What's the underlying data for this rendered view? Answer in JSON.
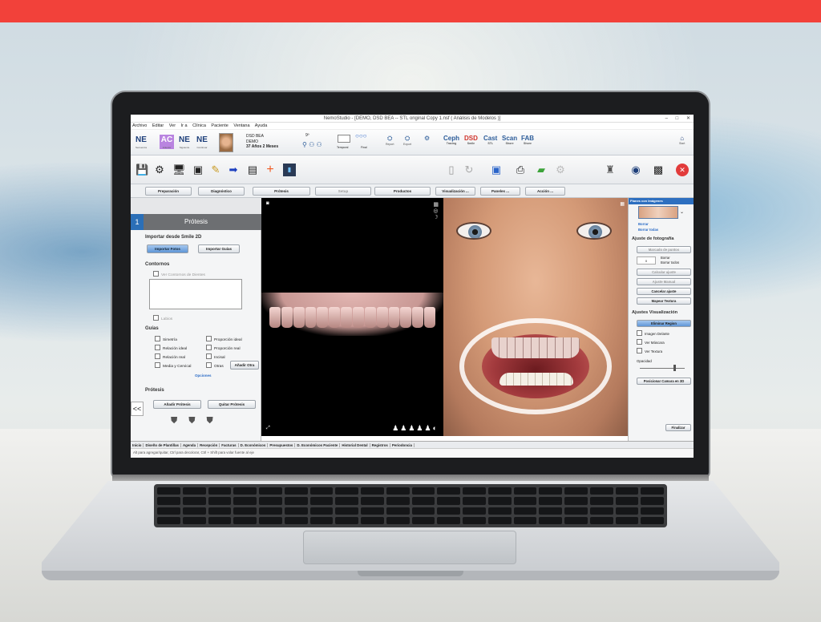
{
  "window": {
    "title": "NemoStudio - [DEMO, DSD BEA -- STL original Copy 1.nsf ( Análisis de Modelos )]",
    "controls": [
      "–",
      "□",
      "✕"
    ]
  },
  "menu": [
    "Archivo",
    "Editar",
    "Ver",
    "Ir a",
    "Clínica",
    "Paciente",
    "Ventana",
    "Ayuda"
  ],
  "toolbar1": {
    "modules": [
      {
        "abbr": "NE",
        "sub": "Secuencia"
      },
      {
        "abbr": "AC",
        "sub": "Anterior"
      },
      {
        "abbr": "NE",
        "sub": "Siguiente"
      },
      {
        "abbr": "NE",
        "sub": "Continuar"
      }
    ],
    "patient": {
      "name": "DSD BEA",
      "id": "DEMO",
      "age": "37 Años 2 Meses",
      "count": "9º"
    },
    "tools": [
      {
        "label": "Ceph",
        "sub": "Tracing"
      },
      {
        "label": "DSD",
        "sub": "Smile"
      },
      {
        "label": "Cast",
        "sub": "STL"
      },
      {
        "label": "Scan",
        "sub": "Shore"
      },
      {
        "label": "FAB",
        "sub": "Shore"
      }
    ],
    "misc": {
      "temporal": "Temporal",
      "final": "Final",
      "report": "Report",
      "export": "Export",
      "start": "Start"
    }
  },
  "tabs": {
    "preparacion": "Preparación",
    "diagnostico": "Diagnóstico",
    "protesis": "Prótesis",
    "setup": "Setup",
    "productos": "Productos",
    "visualizacion": "Visualización ...",
    "paneles": "Paneles ...",
    "accion": "Acción ..."
  },
  "left_panel": {
    "number": "1",
    "title": "Prótesis",
    "importar_section": "Importar desde Smile 2D",
    "importar_fotos": "Importar Fotos",
    "importar_guias": "Importar Guías",
    "contornos_section": "Contornos",
    "ver_contornos": "Ver Contornos de Dientes",
    "labios": "Labios",
    "guias_section": "Guías",
    "guias_left": [
      "Simetría",
      "Relación ideal",
      "Relación real",
      "Media y Cervical"
    ],
    "guias_right": [
      "Proporción ideal",
      "Proporción real",
      "Incisal",
      "Otras"
    ],
    "anadir_otra": "Añadir Otra",
    "opciones": "Opciones",
    "protesis_section": "Prótesis",
    "anadir_protesis": "Añadir Prótesis",
    "quitar_protesis": "Quitar Prótesis",
    "back": "<<"
  },
  "right_panel": {
    "header": "Planes con Imágenes",
    "borrar": "Borrar",
    "borrar_todas": "Borrar todas",
    "ajuste_foto": "Ajuste de fotografía",
    "marcado_puntos": "Marcado de puntos",
    "step_value": "0",
    "borrar2": "Borrar",
    "borrar_todos": "Borrar todos",
    "calcular_ajuste": "Calcular ajuste",
    "ajuste_manual": "Ajuste Manual",
    "cancelar_ajuste": "Cancelar ajuste",
    "mapear_textura": "Mapear Textura",
    "ajustes_visualizacion": "Ajustes Visualización",
    "eliminar_region": "Eliminar Region",
    "imagen_delante": "Imagen Delante",
    "ver_mascara": "Ver Máscara",
    "ver_textura": "Ver Textura",
    "opacidad": "Opacidad",
    "posicionar_camara": "Posicionar Camara en 3D",
    "finalizar": "Finalizar"
  },
  "bottom_tabs": [
    "Inicio",
    "Diseño de Plantillas",
    "Agenda",
    "Recepción",
    "Facturas",
    "D. Económicos",
    "Presupuestos",
    "D. Económicos Paciente",
    "Historial Dental",
    "Registros",
    "Periodoncia"
  ],
  "status": "Alt para agregar/quitar, Ctrl para decolorar, Ctrl + Shift para volar fuente al eje"
}
